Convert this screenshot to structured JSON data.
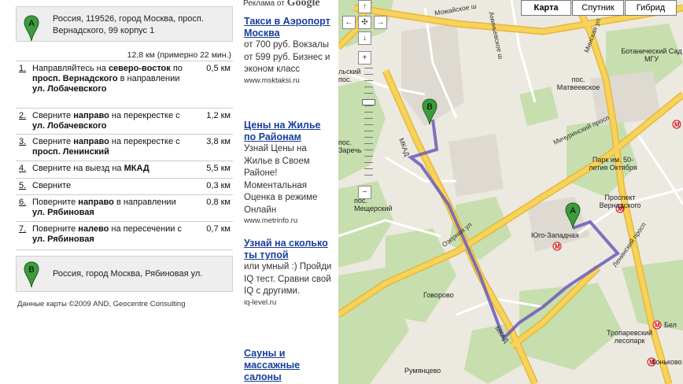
{
  "directions": {
    "start": {
      "marker": "A",
      "address": "Россия, 119526, город Москва, просп. Вернадского, 99 корпус 1"
    },
    "summary": "12,8 км (примерно 22 мин.)",
    "steps": [
      {
        "num": "1.",
        "parts": [
          "Направляйтесь на ",
          "северо-восток",
          " по ",
          "просп. Вернадского",
          " в направлении ",
          "ул. Лобачевского"
        ],
        "distance": "0,5 км"
      },
      {
        "num": "2.",
        "parts": [
          "Сверните ",
          "направо",
          " на перекрестке с ",
          "ул. Лобачевского"
        ],
        "distance": "1,2 км"
      },
      {
        "num": "3.",
        "parts": [
          "Сверните ",
          "направо",
          " на перекрестке с ",
          "просп. Ленинский"
        ],
        "distance": "3,8 км"
      },
      {
        "num": "4.",
        "parts": [
          "Сверните на выезд на ",
          "МКАД"
        ],
        "distance": "5,5 км"
      },
      {
        "num": "5.",
        "parts": [
          "Сверните"
        ],
        "distance": "0,3 км"
      },
      {
        "num": "6.",
        "parts": [
          "Поверните ",
          "направо",
          " в направлении ",
          "ул. Рябиновая"
        ],
        "distance": "0,8 км"
      },
      {
        "num": "7.",
        "parts": [
          "Поверните ",
          "налево",
          " на пересечении с ",
          "ул. Рябиновая"
        ],
        "distance": "0,7 км"
      }
    ],
    "end": {
      "marker": "B",
      "address": "Россия, город Москва, Рябиновая ул."
    },
    "credits": "Данные карты ©2009 AND, Geocentre Consulting"
  },
  "ads": {
    "header_prefix": "Реклама от",
    "header_brand": "Google",
    "items": [
      {
        "title": "Такси в Аэропорт Москва",
        "body": "от 700 руб. Вокзалы от 599 руб. Бизнес и эконом класс",
        "url": "www.msktaksi.ru"
      },
      {
        "title": "Цены на Жилье по Районам",
        "body": "Узнай Цены на Жилье в Своем Районе! Моментальная Оценка в режиме Онлайн",
        "url": "www.metrinfo.ru"
      },
      {
        "title": "Узнай на сколько ты тупой",
        "body": "или умный :) Пройди IQ тест. Сравни свой IQ с другими.",
        "url": "iq-level.ru"
      },
      {
        "title": "Сауны и массажные салоны",
        "body": "",
        "url": ""
      }
    ]
  },
  "map": {
    "type_buttons": [
      "Карта",
      "Спутник",
      "Гибрид"
    ],
    "active_type": "Карта",
    "nav_glyphs": {
      "up": "↑",
      "left": "←",
      "center": "✣",
      "right": "→",
      "down": "↓",
      "zoom_in": "+",
      "zoom_out": "−"
    },
    "place_labels": {
      "mozhaiskoe": "Можайское ш",
      "aminevskoe": "Аминьевское ш",
      "minskaya": "Минская ул",
      "botanic": "Ботанический Сад МГУ",
      "matveevskoe": "пос. Матвеевское",
      "michurinsky": "Мичуринский просп",
      "park": "Парк им. 50-летия Октября",
      "vernadskogo_metro": "Проспект Вернадского",
      "yugo_zapadnaya": "Юго-Западная",
      "leninsky": "Ленинский просп",
      "ozernaya": "Озерная ул",
      "mkad_top": "МКАД",
      "mkad_bottom": "МКАД",
      "pos_mesherskiy": "пос. Мещерский",
      "govorovo": "Говорово",
      "troparevsky": "Тропаревский лесопарк",
      "rumyantsevo": "Румянцево",
      "konkovo": "Коньково",
      "bel": "Бел",
      "zarech": "пос. Заречь",
      "lsky": "льский пос."
    },
    "colors": {
      "route": "#6b5bb8",
      "major_road": "#f7d35b",
      "park": "#c7deae",
      "background": "#ece9e0",
      "marker": "#3d9b3d"
    }
  }
}
